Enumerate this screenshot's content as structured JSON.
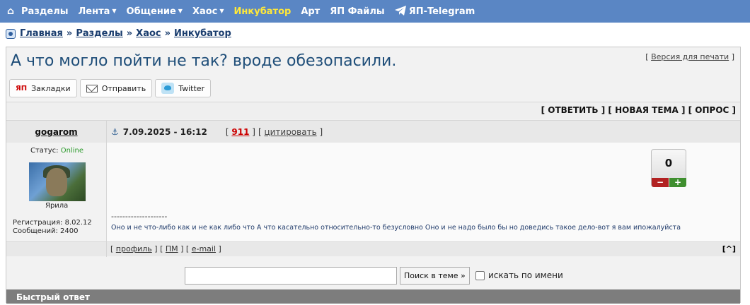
{
  "nav": {
    "home_icon": "⌂",
    "items": [
      {
        "label": "Разделы",
        "dropdown": false,
        "active": false
      },
      {
        "label": "Лента",
        "dropdown": true,
        "active": false
      },
      {
        "label": "Общение",
        "dropdown": true,
        "active": false
      },
      {
        "label": "Хаос",
        "dropdown": true,
        "active": false
      },
      {
        "label": "Инкубатор",
        "dropdown": false,
        "active": true
      },
      {
        "label": "Арт",
        "dropdown": false,
        "active": false
      },
      {
        "label": "ЯП Файлы",
        "dropdown": false,
        "active": false
      },
      {
        "label": "ЯП-Telegram",
        "dropdown": false,
        "active": false
      }
    ]
  },
  "breadcrumb": [
    "Главная",
    "Разделы",
    "Хаос",
    "Инкубатор"
  ],
  "topic": {
    "title": "А что могло пойти не так? вроде обезопасили.",
    "print_label": "Версия для печати"
  },
  "share": {
    "bookmarks_logo": "ЯП",
    "bookmarks": "Закладки",
    "send": "Отправить",
    "twitter": "Twitter"
  },
  "actions": {
    "reply": "[ ОТВЕТИТЬ ]",
    "new_topic": "[ НОВАЯ ТЕМА ]",
    "poll": "[ ОПРОС ]"
  },
  "post": {
    "author": "gogarom",
    "date": "7.09.2025 - 16:12",
    "number": "911",
    "quote_label": "цитировать",
    "status_label": "Статус:",
    "status_value": "Online",
    "avatar_caption": "Ярила",
    "registration": "Регистрация: 8.02.12",
    "messages": "Сообщений: 2400",
    "rating": "0",
    "rating_minus": "−",
    "rating_plus": "+",
    "signature_line": "--------------------",
    "text": "Оно и не что-либо как и не как либо что А что касательно относительно-то безусловно Оно и не надо было бы но доведись такое дело-вот я вам ипожалуйста",
    "profile": "профиль",
    "pm": "ПМ",
    "email": "e-mail",
    "to_top": "[^]"
  },
  "search": {
    "value": "",
    "button": "Поиск в теме »",
    "by_name_label": "искать по имени",
    "by_name_checked": false
  },
  "quick_reply": "Быстрый ответ"
}
